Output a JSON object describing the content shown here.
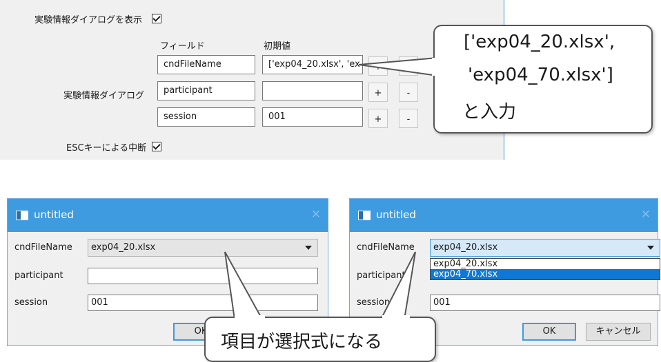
{
  "settings": {
    "show_dialog_label": "実験情報ダイアログを表示",
    "show_dialog_checked": true,
    "dialog_label": "実験情報ダイアログ",
    "field_header": "フィールド",
    "initial_header": "初期値",
    "rows": [
      {
        "field": "cndFileName",
        "value": "['exp04_20.xlsx', 'ex"
      },
      {
        "field": "participant",
        "value": ""
      },
      {
        "field": "session",
        "value": "001"
      }
    ],
    "plus_label": "+",
    "minus_label": "-",
    "esc_label": "ESCキーによる中断",
    "esc_checked": true
  },
  "callout_top": {
    "line1": "['exp04_20.xlsx',",
    "line2": "'exp04_70.xlsx']",
    "line3": "と入力"
  },
  "dialog_left": {
    "title": "untitled",
    "close": "×",
    "fields": [
      {
        "label": "cndFileName",
        "value": "exp04_20.xlsx"
      },
      {
        "label": "participant",
        "value": ""
      },
      {
        "label": "session",
        "value": "001"
      }
    ],
    "ok_label": "OK"
  },
  "dialog_right": {
    "title": "untitled",
    "close": "×",
    "fields": [
      {
        "label": "cndFileName",
        "value": "exp04_20.xlsx"
      },
      {
        "label": "participant",
        "value": ""
      },
      {
        "label": "session",
        "value": "001"
      }
    ],
    "dropdown_options": [
      "exp04_20.xlsx",
      "exp04_70.xlsx"
    ],
    "dropdown_selected": "exp04_70.xlsx",
    "ok_label": "OK",
    "cancel_label": "キャンセル"
  },
  "callout_bottom": {
    "text": "項目が選択式になる"
  },
  "colors": {
    "titlebar": "#3e9be0",
    "panel_bg": "#f0f0f0",
    "selection": "#0f78d7"
  }
}
